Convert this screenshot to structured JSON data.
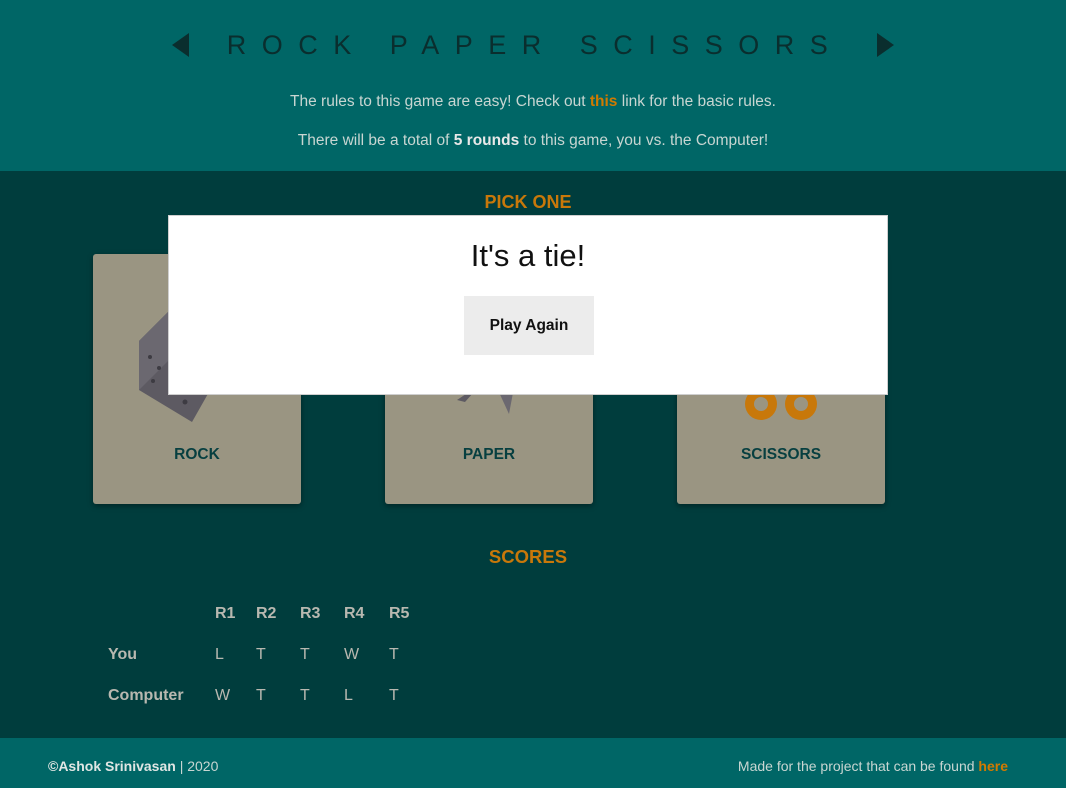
{
  "header": {
    "title": "ROCK PAPER SCISSORS",
    "rules_line1_before": "The rules to this game are easy! Check out ",
    "rules_line1_link": "this",
    "rules_line1_after": " link for the basic rules.",
    "rules_line2_before": "There will be a total of ",
    "rules_line2_strong": "5 rounds",
    "rules_line2_after": " to this game, you vs. the Computer!"
  },
  "pick": {
    "title": "PICK ONE",
    "choices": [
      {
        "label": "ROCK",
        "icon": "rock-icon"
      },
      {
        "label": "PAPER",
        "icon": "paper-icon"
      },
      {
        "label": "SCISSORS",
        "icon": "scissors-icon"
      }
    ]
  },
  "modal": {
    "message": "It's a tie!",
    "button_label": "Play Again"
  },
  "scores": {
    "title": "SCORES",
    "rounds": [
      "R1",
      "R2",
      "R3",
      "R4",
      "R5"
    ],
    "rows": [
      {
        "label": "You",
        "results": [
          "L",
          "T",
          "T",
          "W",
          "T"
        ]
      },
      {
        "label": "Computer",
        "results": [
          "W",
          "T",
          "T",
          "L",
          "T"
        ]
      }
    ]
  },
  "footer": {
    "author": "©Ashok Srinivasan",
    "year_text": " | 2020",
    "project_text": "Made for the project that can be found ",
    "project_link": "here"
  },
  "colors": {
    "header_bg": "#006666",
    "body_bg": "#003d3d",
    "accent": "#d17a00",
    "card_bg": "#9a9582"
  }
}
